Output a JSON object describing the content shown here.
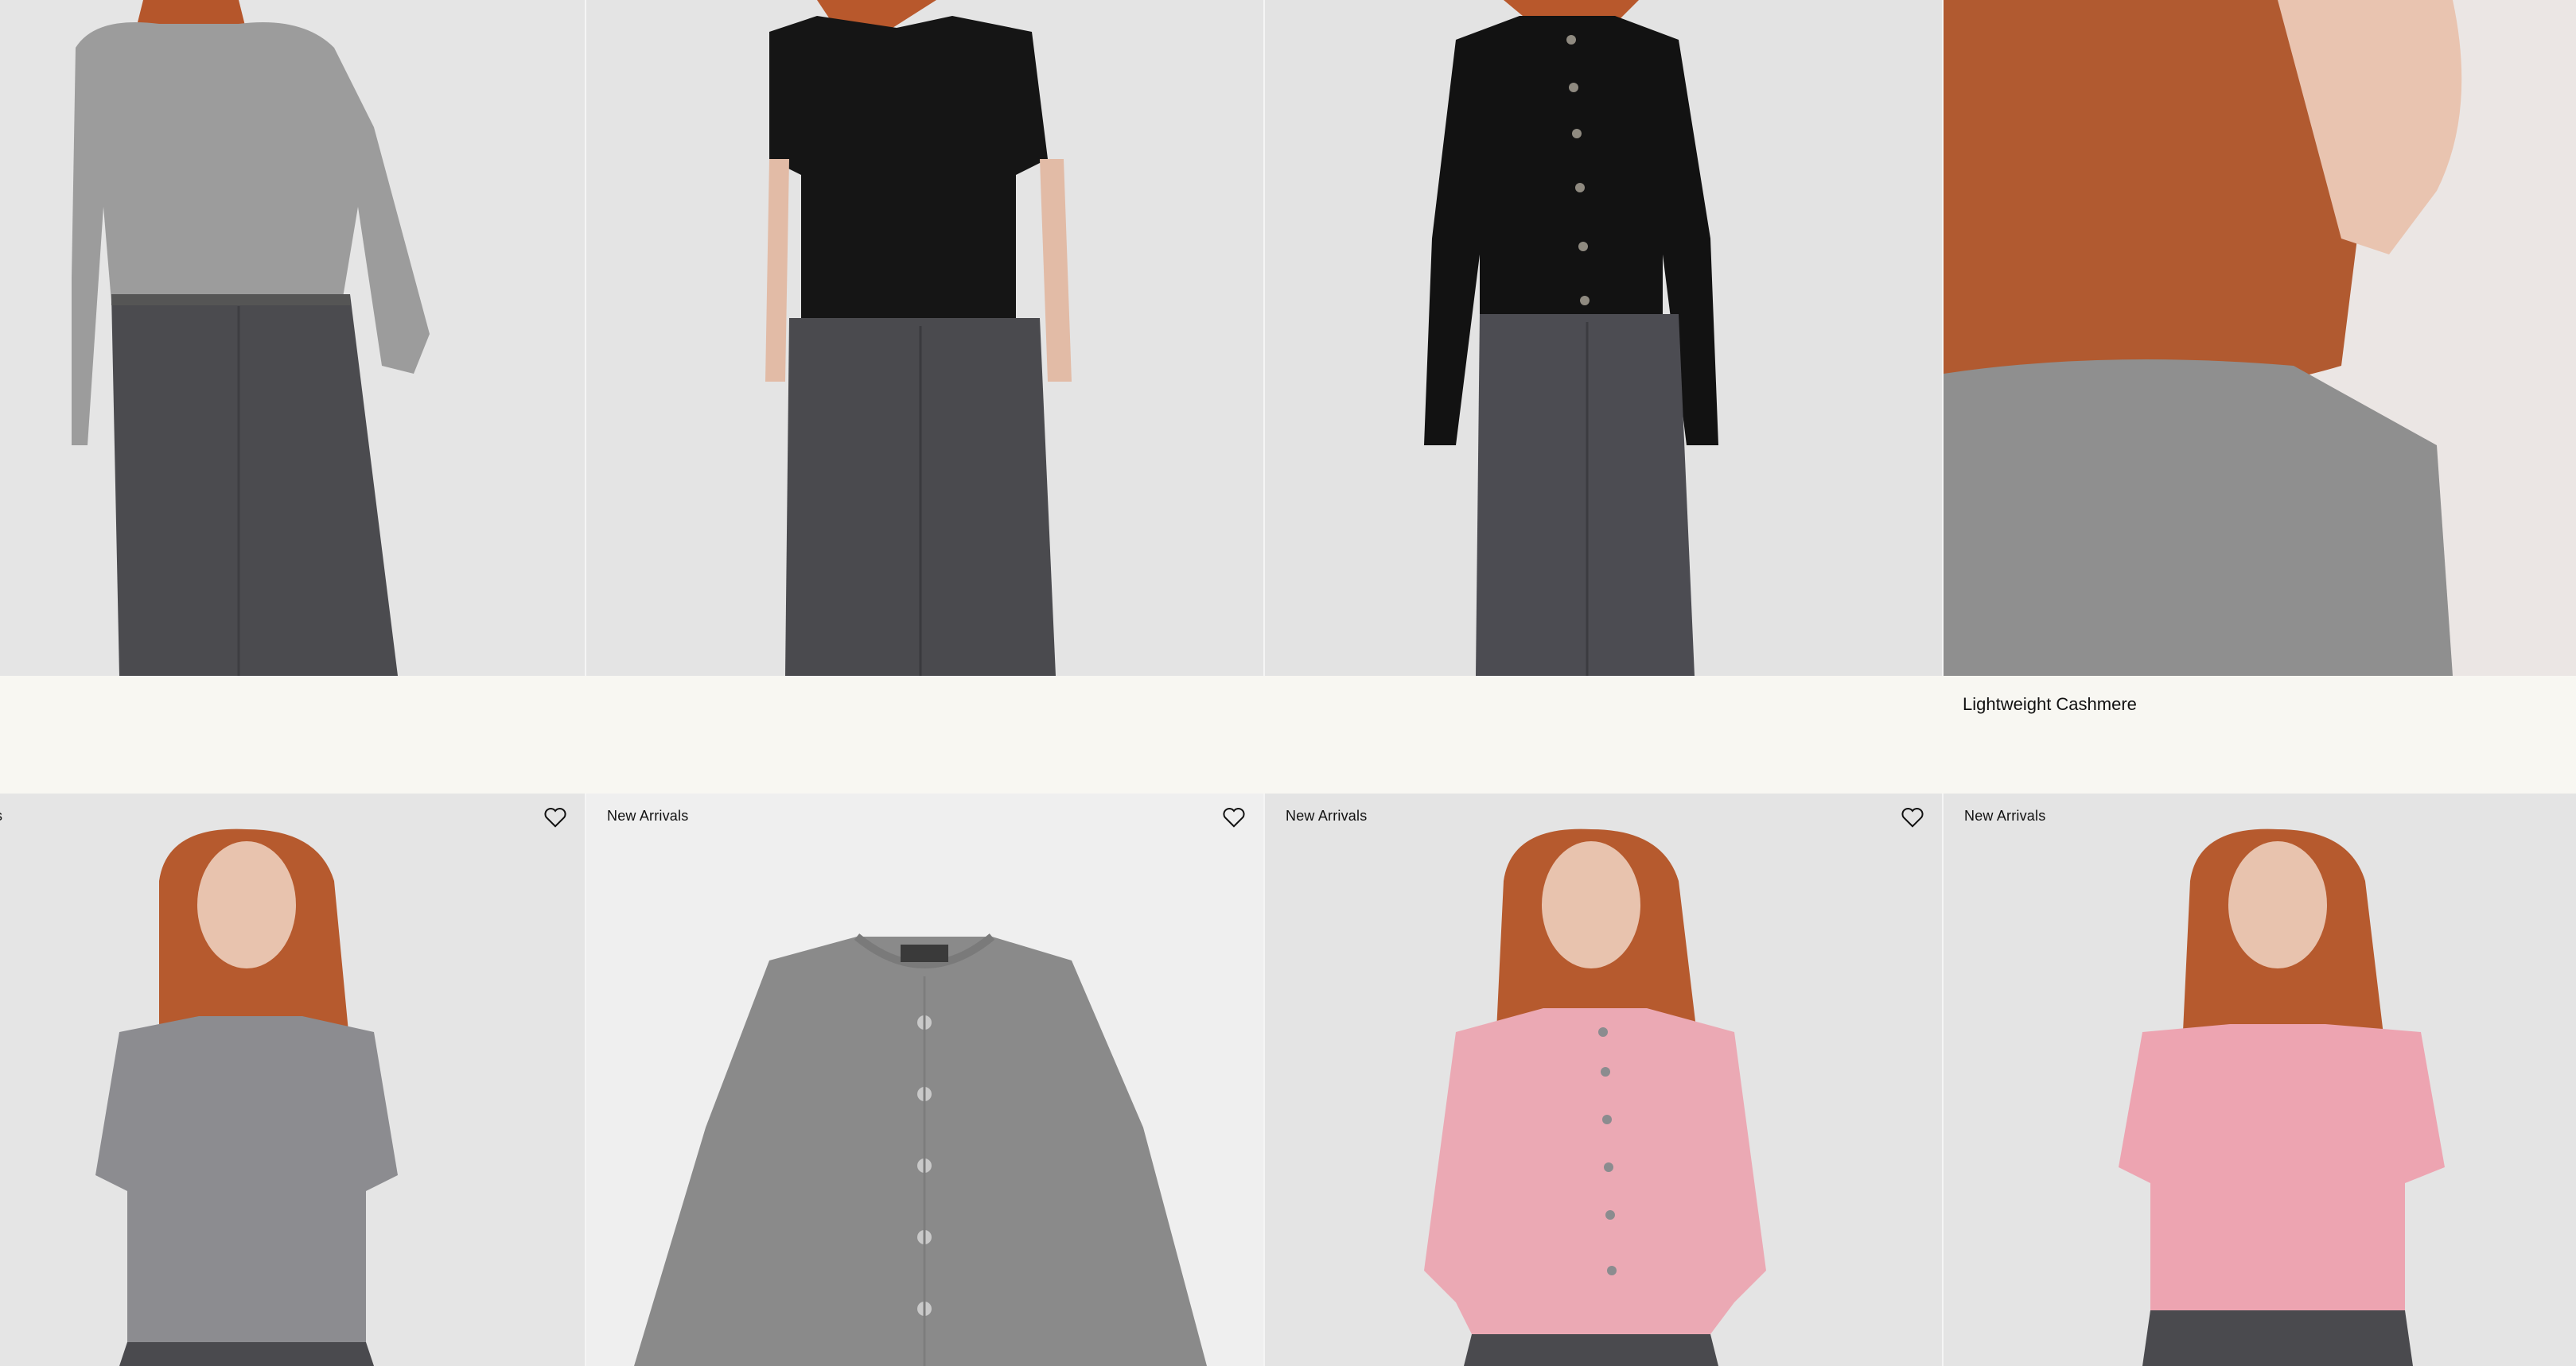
{
  "grid": {
    "top_row": [
      {
        "name": "grey-turtleneck-look",
        "garment_color": "#9b9b9b",
        "bottom_color": "#4a4a4e"
      },
      {
        "name": "black-tee-look",
        "garment_color": "#141414",
        "bottom_color": "#4a4a4e"
      },
      {
        "name": "black-cardigan-look",
        "garment_color": "#121212",
        "bottom_color": "#4c4c52"
      },
      {
        "name": "closeup-portrait",
        "garment_color": "#8f8f8f",
        "hair_color": "#b65a2e"
      }
    ],
    "feature_caption": "Lightweight Cashmere",
    "bottom_row": [
      {
        "badge": "s",
        "badge_full": "New Arrivals",
        "garment_color": "#8c8c90"
      },
      {
        "badge": "New Arrivals",
        "garment_color": "#8a8a8a"
      },
      {
        "badge": "New Arrivals",
        "garment_color": "#eba9b4"
      },
      {
        "badge": "New Arrivals",
        "garment_color": "#eda4b1"
      }
    ]
  },
  "icons": {
    "wishlist": "heart-outline-icon"
  },
  "colors": {
    "background": "#f8f7f2",
    "tile_bg": "#e4e4e4",
    "hair": "#b65a2e",
    "skin": "#e9c4b0"
  }
}
